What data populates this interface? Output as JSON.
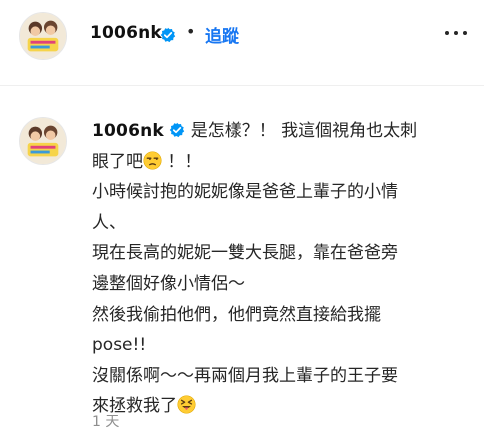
{
  "header": {
    "username": "1006nk",
    "separator": "•",
    "follow_label": "追蹤"
  },
  "comment": {
    "username": "1006nk",
    "lines": [
      "是怎樣？！ 我這個視角也太刺",
      "眼了吧",
      "！！",
      "小時候討抱的妮妮像是爸爸上輩子的小情",
      "人、",
      "現在長高的妮妮一雙大長腿，靠在爸爸旁",
      "邊整個好像小情侶～",
      "然後我偷拍他們，他們竟然直接給我擺",
      "pose!!",
      "沒關係啊～～再兩個月我上輩子的王子要",
      "來拯救我了"
    ],
    "timestamp": "1 天"
  },
  "colors": {
    "accent": "#1877f2",
    "text": "#262626",
    "muted": "#8e8e8e",
    "verified": "#0095f6"
  }
}
